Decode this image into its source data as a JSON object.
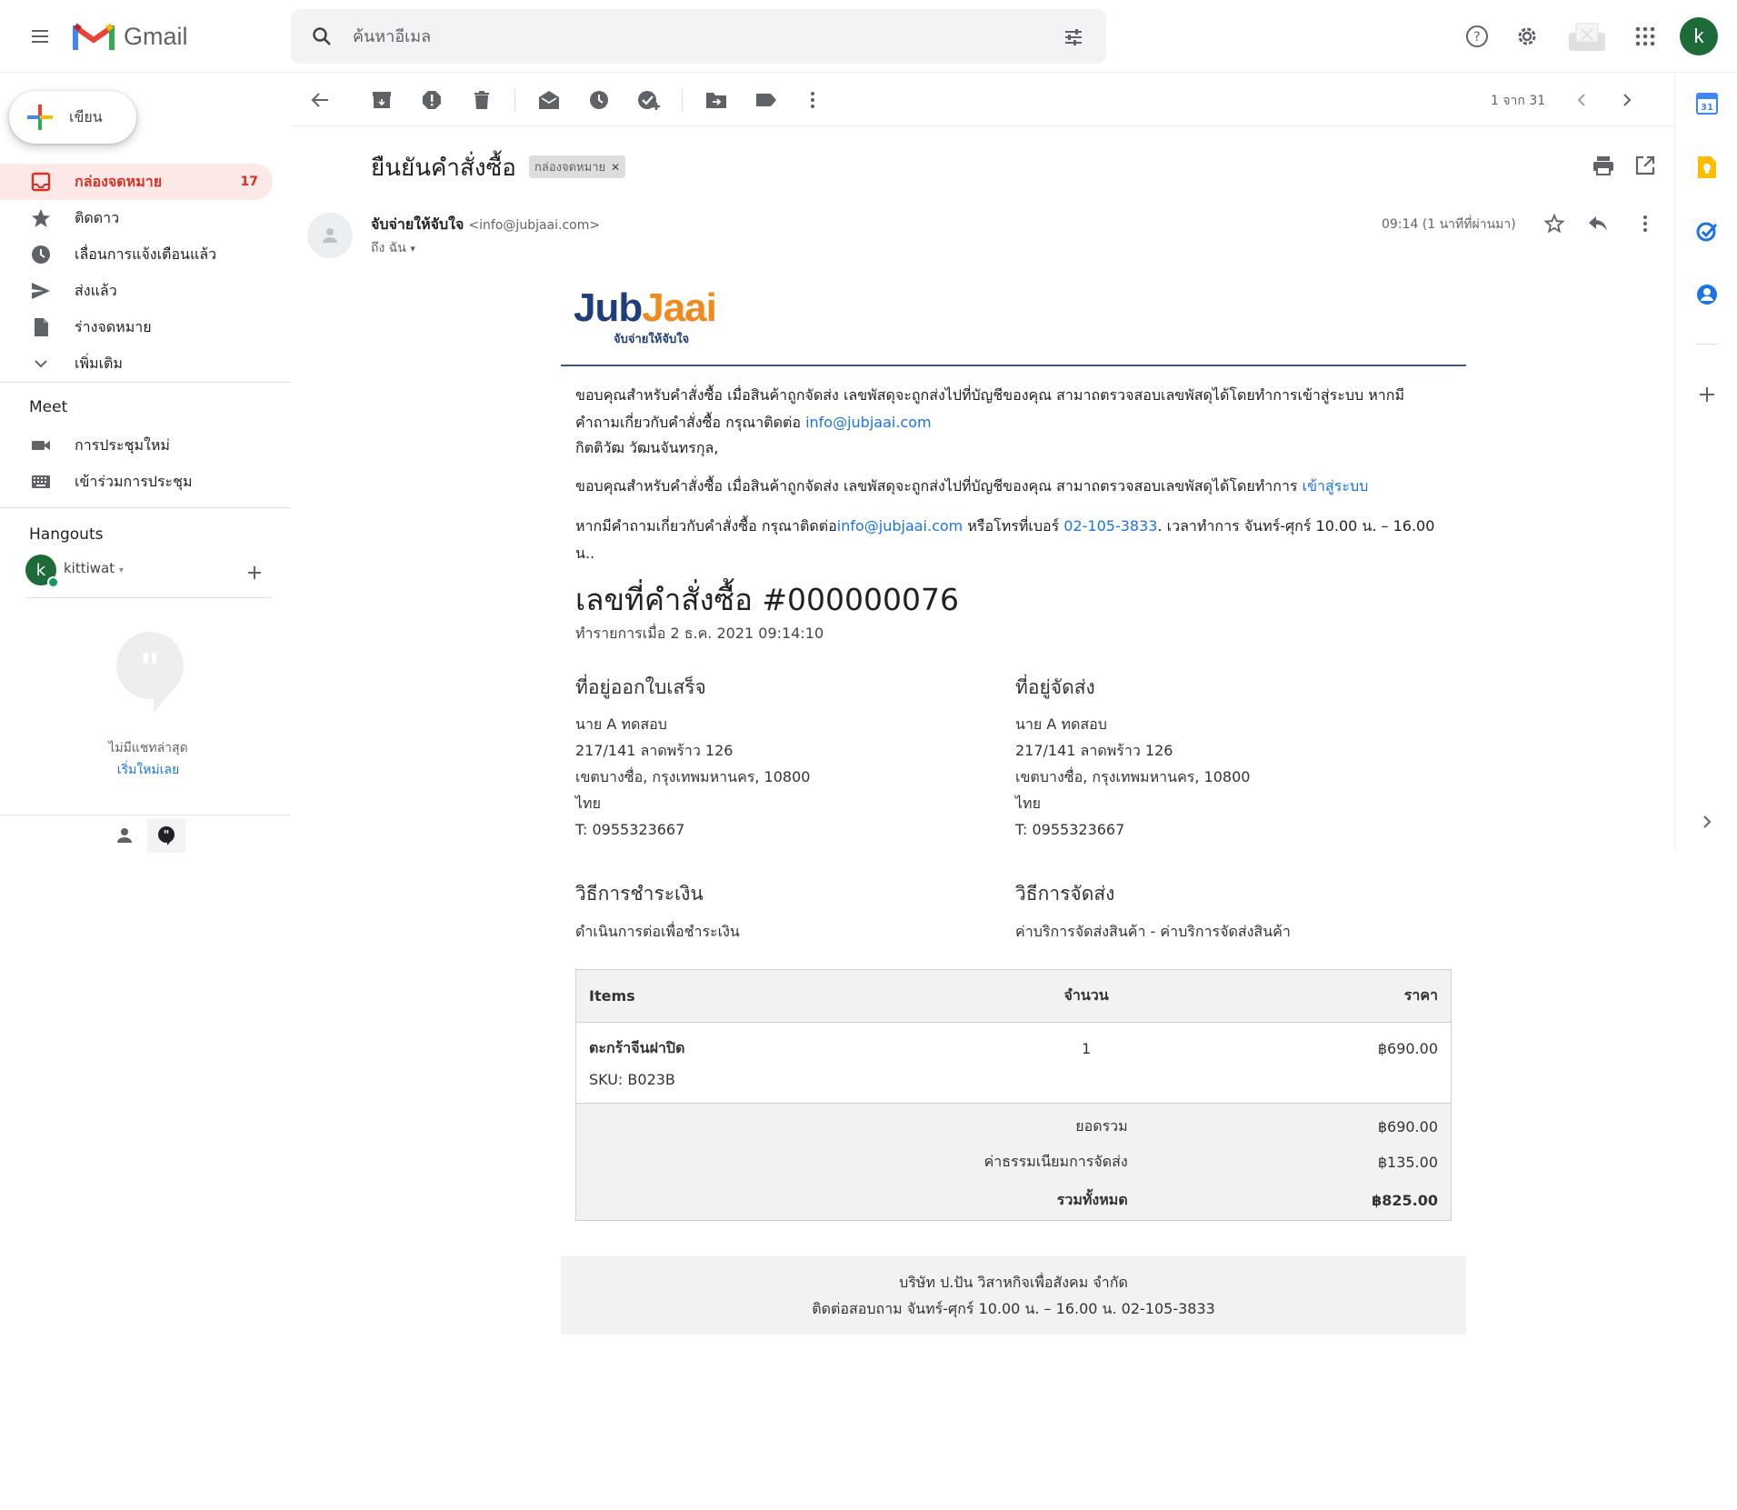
{
  "app": {
    "name": "Gmail"
  },
  "search": {
    "placeholder": "ค้นหาอีเมล"
  },
  "user": {
    "initial": "k"
  },
  "sidebar": {
    "compose_label": "เขียน",
    "items": [
      {
        "label": "กล่องจดหมาย",
        "count": "17",
        "icon": "inbox-icon"
      },
      {
        "label": "ติดดาว",
        "icon": "star-icon"
      },
      {
        "label": "เลื่อนการแจ้งเตือนแล้ว",
        "icon": "clock-icon"
      },
      {
        "label": "ส่งแล้ว",
        "icon": "send-icon"
      },
      {
        "label": "ร่างจดหมาย",
        "icon": "draft-icon"
      },
      {
        "label": "เพิ่มเติม",
        "icon": "chevron-down-icon"
      }
    ],
    "meet_title": "Meet",
    "meet_items": [
      {
        "label": "การประชุมใหม่",
        "icon": "video-icon"
      },
      {
        "label": "เข้าร่วมการประชุม",
        "icon": "keyboard-icon"
      }
    ],
    "hangouts_title": "Hangouts",
    "hangouts_user": "kittiwat",
    "no_chats": "ไม่มีแชทล่าสุด",
    "start_new": "เริ่มใหม่เลย"
  },
  "toolbar": {
    "pager": "1 จาก 31"
  },
  "email": {
    "subject": "ยืนยันคำสั่งซื้อ",
    "label_chip": "กล่องจดหมาย",
    "sender_name": "จับจ่ายให้จับใจ",
    "sender_email": "<info@jubjaai.com>",
    "to": "ถึง ฉัน",
    "time": "09:14 (1 นาทีที่ผ่านมา)"
  },
  "body": {
    "brand_name": "JubJaai",
    "brand_tagline": "จับจ่ายให้จับใจ",
    "p1_text": "ขอบคุณสำหรับคำสั่งซื้อ เมื่อสินค้าถูกจัดส่ง เลขพัสดุจะถูกส่งไปที่บัญชีของคุณ สามาถตรวจสอบเลขพัสดุได้โดยทำการเข้าสู่ระบบ หากมีคำถามเกี่ยวกับคำสั่งซื้อ กรุณาติดต่อ ",
    "p1_link": "info@jubjaai.com",
    "greeting": "กิตติวัฒ วัฒนจันทรกุล,",
    "p2_text": "ขอบคุณสำหรับคำสั่งซื้อ เมื่อสินค้าถูกจัดส่ง เลขพัสดุจะถูกส่งไปที่บัญชีของคุณ สามาถตรวจสอบเลขพัสดุได้โดยทำการ ",
    "p2_link": "เข้าสู่ระบบ",
    "p3_text1": "หากมีคำถามเกี่ยวกับคำสั่งซื้อ กรุณาติดต่อ",
    "p3_link1": "info@jubjaai.com",
    "p3_text2": " หรือโทรที่เบอร์ ",
    "p3_link2": "02-105-3833",
    "p3_text3": ". เวลาทำการ จันทร์-ศุกร์ 10.00 น. – 16.00 น..",
    "order_title": "เลขที่คำสั่งซื้อ #000000076",
    "order_date": "ทำรายการเมื่อ 2 ธ.ค. 2021 09:14:10",
    "billing_title": "ที่อยู่ออกใบเสร็จ",
    "shipping_title": "ที่อยู่จัดส่ง",
    "address": [
      "นาย A ทดสอบ",
      "217/141 ลาดพร้าว 126",
      "เขตบางซื่อ, กรุงเทพมหานคร, 10800",
      "ไทย",
      "T: 0955323667"
    ],
    "payment_title": "วิธีการชำระเงิน",
    "payment_value": "ดำเนินการต่อเพื่อชำระเงิน",
    "shipping_method_title": "วิธีการจัดส่ง",
    "shipping_method_value": "ค่าบริการจัดส่งสินค้า - ค่าบริการจัดส่งสินค้า",
    "table": {
      "headers": [
        "Items",
        "จำนวน",
        "ราคา"
      ],
      "item_name": "ตะกร้าจีนฝาปิด",
      "item_sku": "SKU: B023B",
      "item_qty": "1",
      "item_price": "฿690.00",
      "subtotal_label": "ยอดรวม",
      "subtotal": "฿690.00",
      "shipping_label": "ค่าธรรมเนียมการจัดส่ง",
      "shipping": "฿135.00",
      "total_label": "รวมทั้งหมด",
      "total": "฿825.00"
    },
    "footer_line1": "บริษัท ป.ปัน วิสาหกิจเพื่อสังคม จำกัด",
    "footer_line2": "ติดต่อสอบถาม จันทร์-ศุกร์ 10.00 น. – 16.00 น. 02-105-3833"
  },
  "colors": {
    "accent": "#d93025",
    "link": "#1a73e8",
    "brand_blue": "#1e3f7a",
    "brand_orange": "#f08a1c"
  }
}
